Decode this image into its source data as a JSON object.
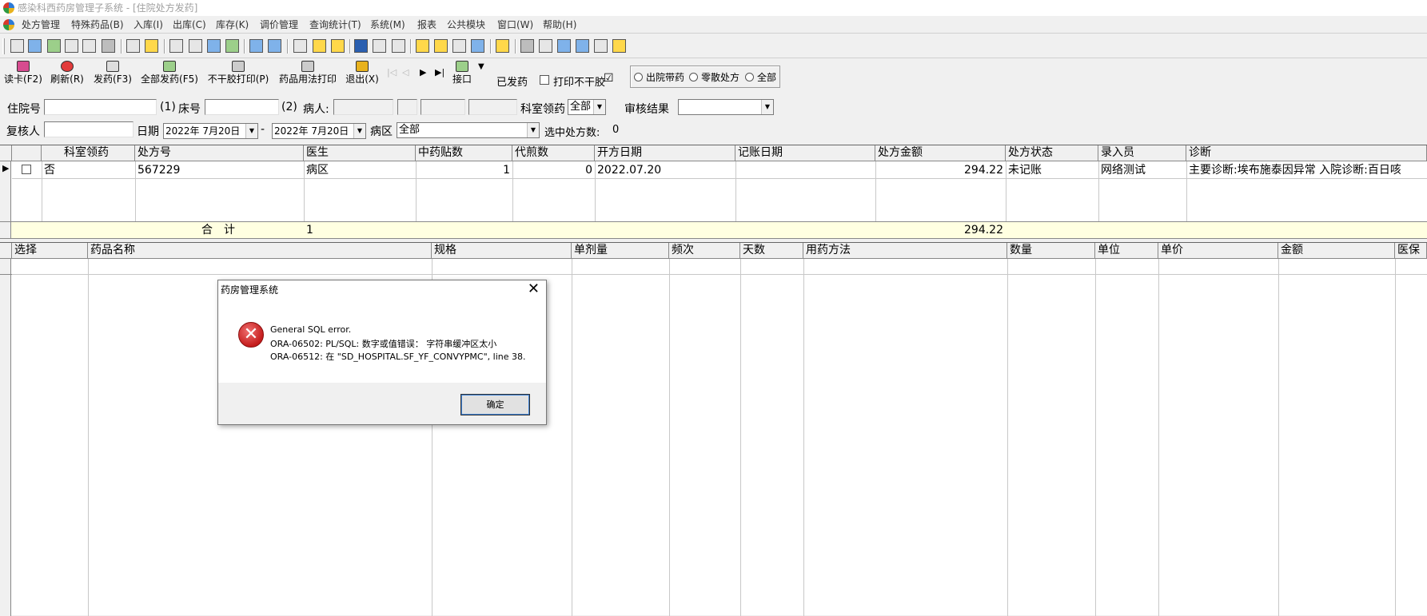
{
  "window": {
    "title": "感染科西药房管理子系统 - [住院处方发药]"
  },
  "menu": [
    "处方管理",
    "特殊药品(B)",
    "入库(I)",
    "出库(C)",
    "库存(K)",
    "调价管理",
    "查询统计(T)",
    "系统(M)",
    "报表",
    "公共模块",
    "窗口(W)",
    "帮助(H)"
  ],
  "toolbar2": {
    "read_card": "读卡(F2)",
    "refresh": "刷新(R)",
    "dispense": "发药(F3)",
    "dispense_all": "全部发药(F5)",
    "print_no_dry": "不干胶打印(P)",
    "print_usage": "药品用法打印",
    "exit": "退出(X)",
    "interface": "接口",
    "dispensed": "已发药",
    "no_dry_label": "打印不干胶",
    "no_dry_checked": true,
    "radio_options": [
      "出院带药",
      "零散处方",
      "全部"
    ]
  },
  "filters": {
    "inpatient_no_label": "住院号",
    "mark1": "(1)",
    "bed_label": "床号",
    "mark2": "(2)",
    "patient_label": "病人:",
    "dept_collect_label": "科室领药",
    "dept_collect_value": "全部",
    "review_result_label": "审核结果",
    "review_result_value": "",
    "reviewer_label": "复核人",
    "date_label": "日期",
    "date_from": "2022年 7月20日",
    "date_sep": "-",
    "date_to": "2022年 7月20日",
    "ward_label": "病区",
    "ward_value": "全部",
    "selected_count_label": "选中处方数:",
    "selected_count": "0"
  },
  "grid1": {
    "headers": [
      "科室领药",
      "处方号",
      "医生",
      "中药贴数",
      "代煎数",
      "开方日期",
      "记账日期",
      "处方金额",
      "处方状态",
      "录入员",
      "诊断"
    ],
    "rows": [
      {
        "checked": false,
        "dept_collect": "否",
        "rx_no": "567229",
        "doctor": "病区",
        "herbal_count": "1",
        "decoct_count": "0",
        "open_date": "2022.07.20",
        "bill_date": "",
        "amount": "294.22",
        "status": "未记账",
        "entered_by": "网络测试",
        "diagnosis": "主要诊断:埃布施泰因异常 入院诊断:百日咳"
      }
    ],
    "summary": {
      "label": "合　计",
      "count": "1",
      "amount": "294.22"
    }
  },
  "grid2": {
    "headers": [
      "选择",
      "药品名称",
      "规格",
      "单剂量",
      "频次",
      "天数",
      "用药方法",
      "数量",
      "单位",
      "单价",
      "金额",
      "医保"
    ]
  },
  "dialog": {
    "title": "药房管理系统",
    "line1": "General SQL error.",
    "line2": "ORA-06502: PL/SQL: 数字或值错误： 字符串缓冲区太小",
    "line3": "ORA-06512: 在 \"SD_HOSPITAL.SF_YF_CONVYPMC\", line 38.",
    "ok": "确定"
  }
}
